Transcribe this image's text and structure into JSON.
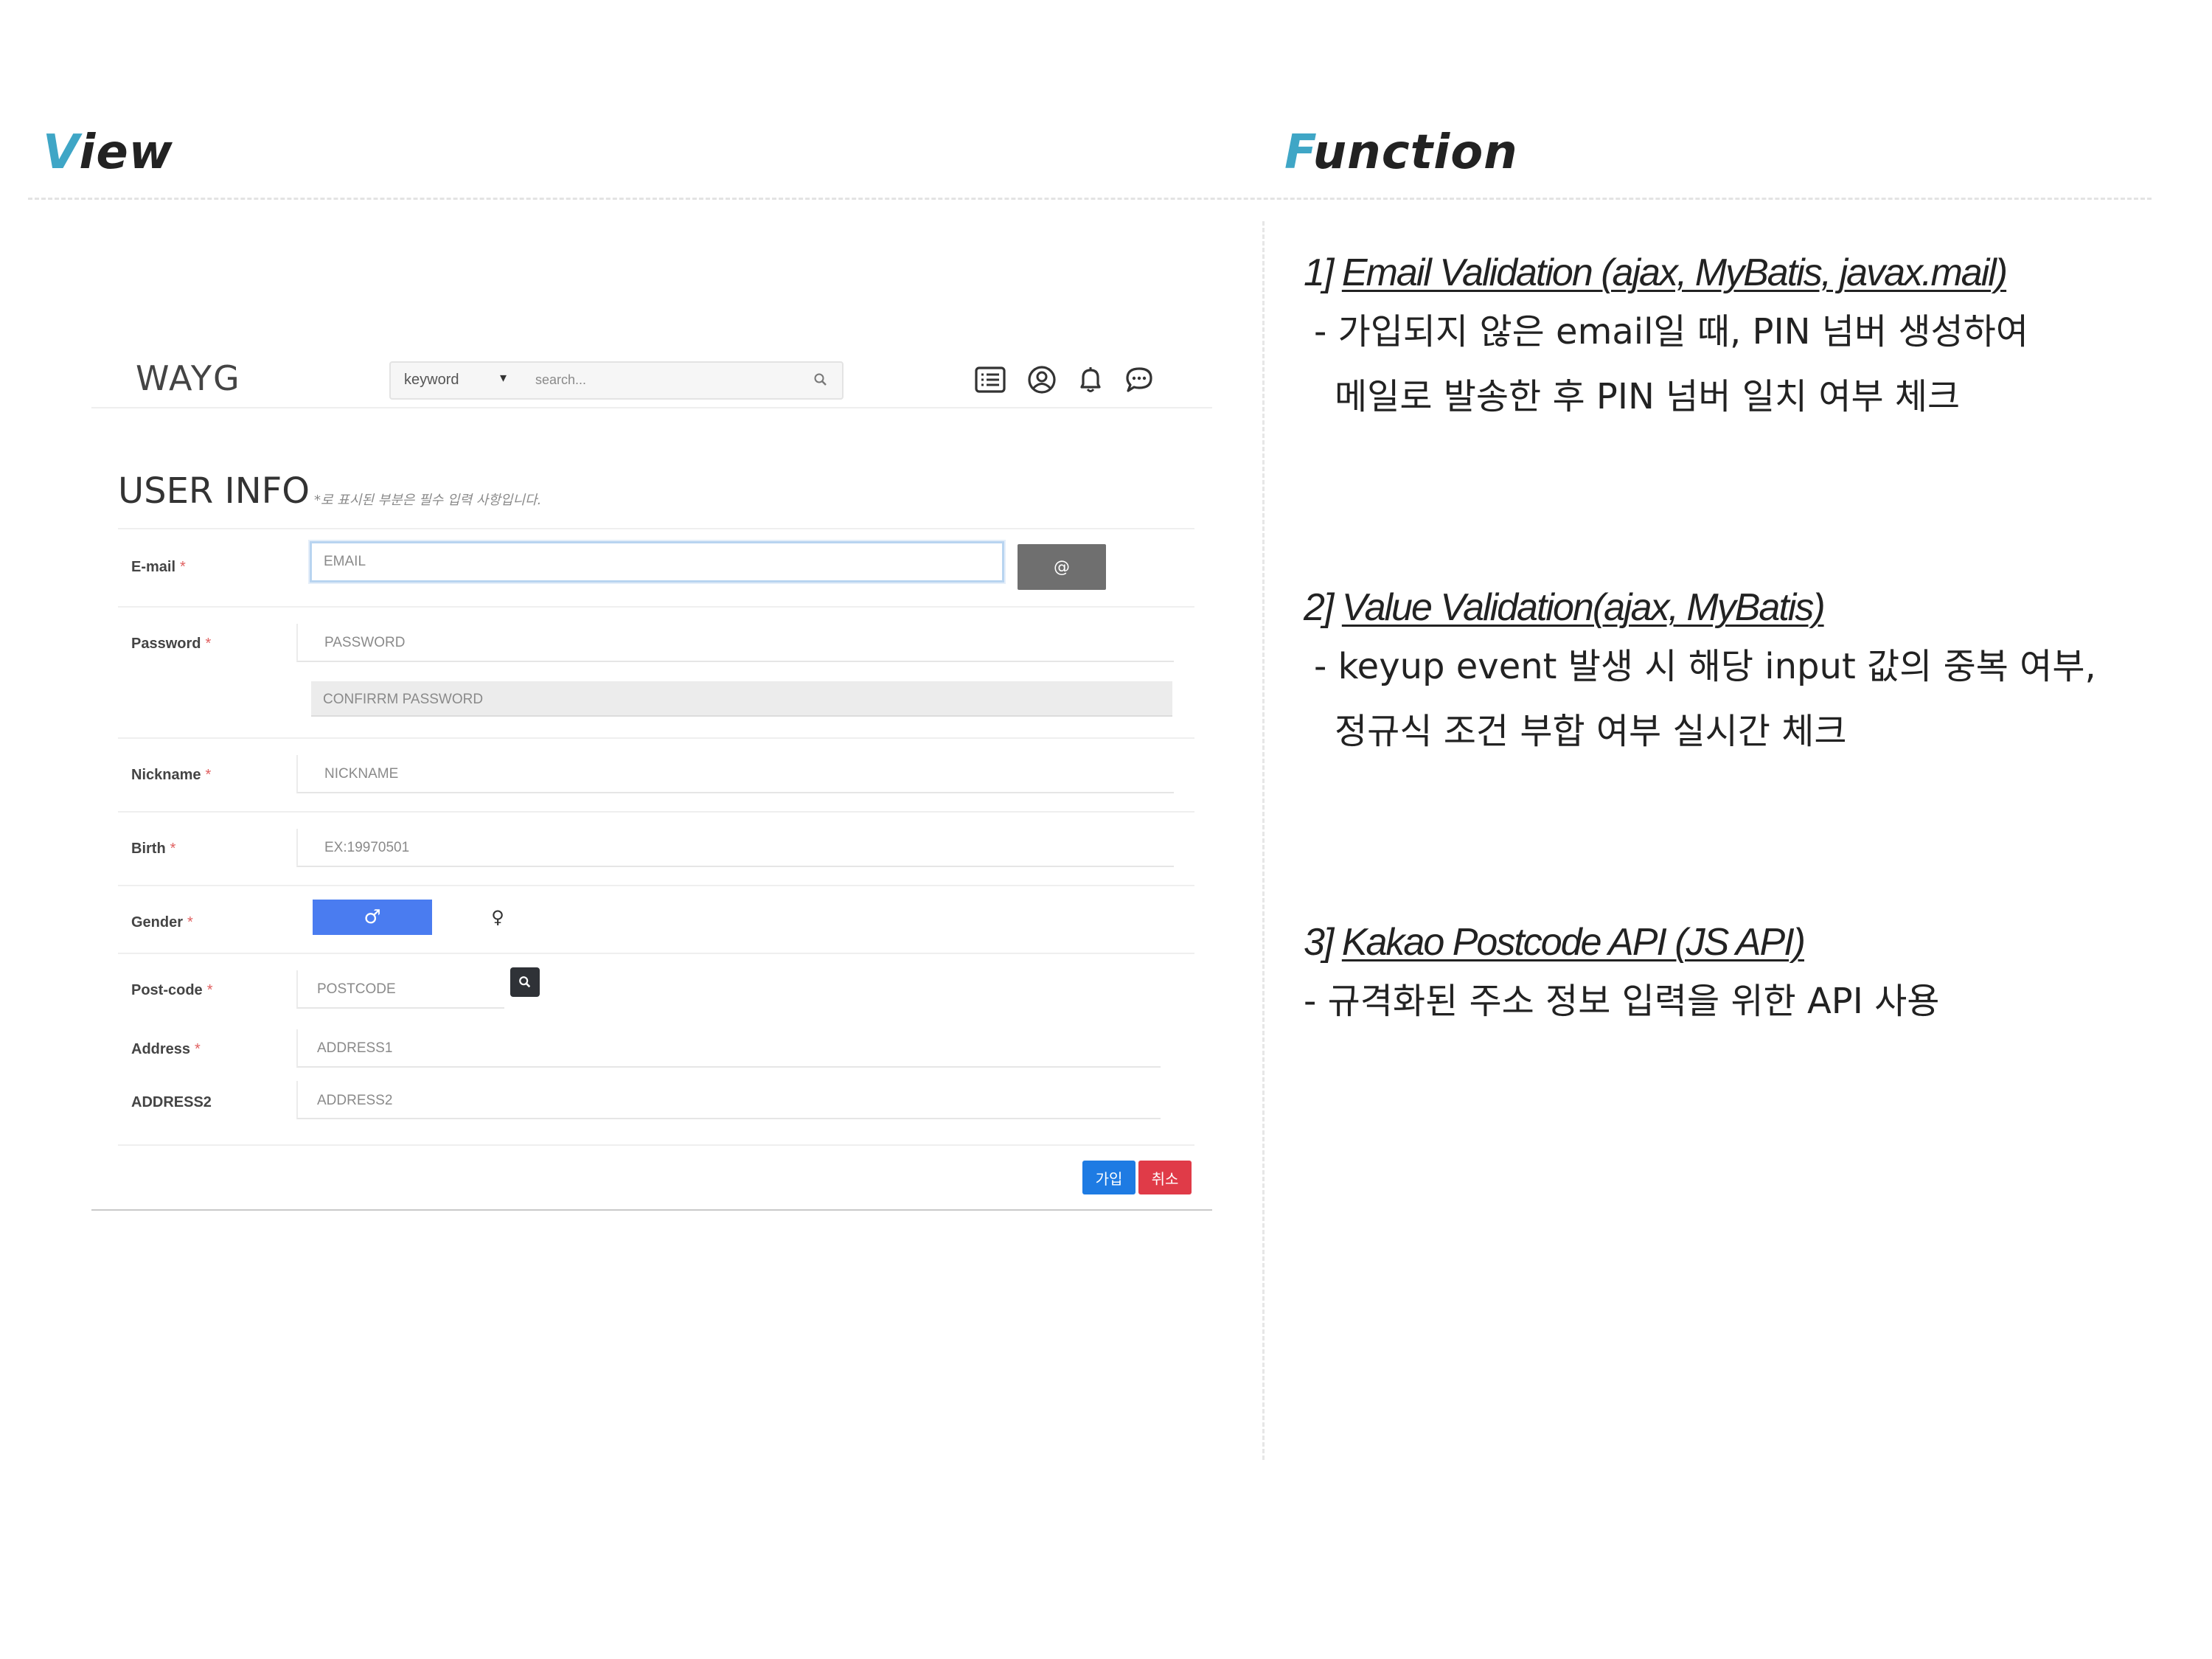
{
  "slide": {
    "view_heading": {
      "first": "V",
      "rest": "iew"
    },
    "function_heading": {
      "first": "F",
      "rest": "unction"
    }
  },
  "app": {
    "logo": "WAYG",
    "search": {
      "keyword_label": "keyword",
      "placeholder": "search..."
    },
    "nav_icons": [
      "list-icon",
      "user-circle-icon",
      "bell-icon",
      "chat-icon"
    ],
    "page_title": "USER INFO",
    "page_note": "*로 표시된 부분은 필수 입력 사항입니다.",
    "required_mark": "*",
    "form": {
      "email_label": "E-mail",
      "email_placeholder": "EMAIL",
      "email_button_glyph": "@",
      "password_label": "Password",
      "password_placeholder": "PASSWORD",
      "confirm_placeholder": "CONFIRRM PASSWORD",
      "nickname_label": "Nickname",
      "nickname_placeholder": "NICKNAME",
      "birth_label": "Birth",
      "birth_placeholder": "EX:19970501",
      "gender_label": "Gender",
      "gender_male_glyph": "♂",
      "gender_female_glyph": "♀",
      "postcode_label": "Post-code",
      "postcode_placeholder": "POSTCODE",
      "address_label": "Address",
      "address_placeholder": "ADDRESS1",
      "address2_label": "ADDRESS2",
      "address2_placeholder": "ADDRESS2"
    },
    "buttons": {
      "join": "가입",
      "cancel": "취소"
    },
    "colors": {
      "primary": "#4a7cf0",
      "join": "#1e7be3",
      "cancel": "#e03b48",
      "email_button": "#6f6f6f"
    }
  },
  "functions": [
    {
      "number": "1]",
      "title": "Email Validation (ajax, MyBatis, javax.mail)",
      "lines": [
        "- 가입되지 않은 email일 때, PIN 넘버 생성하여",
        "메일로 발송한 후 PIN 넘버 일치 여부 체크"
      ]
    },
    {
      "number": "2]",
      "title": "Value Validation(ajax, MyBatis)",
      "lines": [
        "- keyup event 발생 시 해당 input 값의 중복 여부,",
        "정규식 조건 부합 여부 실시간 체크"
      ]
    },
    {
      "number": "3]",
      "title": "Kakao Postcode API (JS API)",
      "lines": [
        "- 규격화된 주소 정보 입력을 위한 API 사용"
      ]
    }
  ],
  "accent_color": "#3fa6c6"
}
